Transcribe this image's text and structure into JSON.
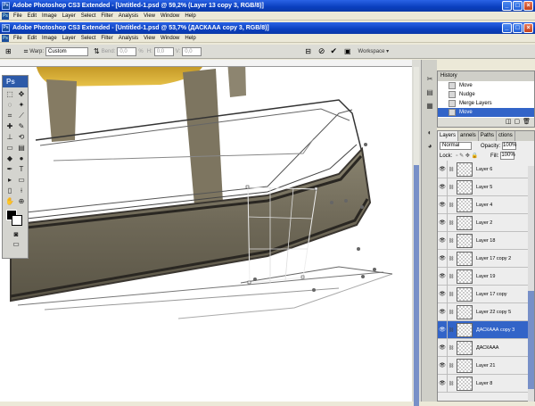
{
  "window1": {
    "title": "Adobe Photoshop CS3 Extended - [Untitled-1.psd @ 59,2% (Layer 13 copy 3, RGB/8)]"
  },
  "window2": {
    "title": "Adobe Photoshop CS3 Extended - [Untitled-1.psd @ 53,7% (ДАСКААА copy 3, RGB/8)]"
  },
  "menu": [
    "File",
    "Edit",
    "Image",
    "Layer",
    "Select",
    "Filter",
    "Analysis",
    "View",
    "Window",
    "Help"
  ],
  "options": {
    "warp_label": "Warp:",
    "warp_value": "Custom",
    "bend_label": "Bend:",
    "bend_value": "0,0",
    "bend_unit": "%",
    "h_label": "H:",
    "h_value": "0,0",
    "v_label": "V:",
    "v_value": "0,0",
    "workspace": "Workspace ▾"
  },
  "toolbox": {
    "logo": "Ps"
  },
  "history": {
    "tab": "History",
    "items": [
      "Move",
      "Nudge",
      "Merge Layers",
      "Move"
    ],
    "selected_index": 3
  },
  "layers": {
    "tabs": [
      "Layers",
      "annels",
      "Paths",
      "ctions"
    ],
    "blend_mode": "Normal",
    "opacity_label": "Opacity:",
    "opacity": "100%",
    "lock_label": "Lock:",
    "fill_label": "Fill:",
    "fill": "100%",
    "rows": [
      "Layer 6",
      "Layer 5",
      "Layer 4",
      "Layer 2",
      "Layer 18",
      "Layer 17 copy 2",
      "Layer 19",
      "Layer 17 copy",
      "Layer 22 copy 5",
      "ДАСКААА copy 3",
      "ДАСКААА",
      "Layer 21",
      "Layer 8"
    ],
    "selected_row": 9
  },
  "colors": {
    "title_blue": "#0a3fbf",
    "selection_blue": "#3264c8"
  }
}
